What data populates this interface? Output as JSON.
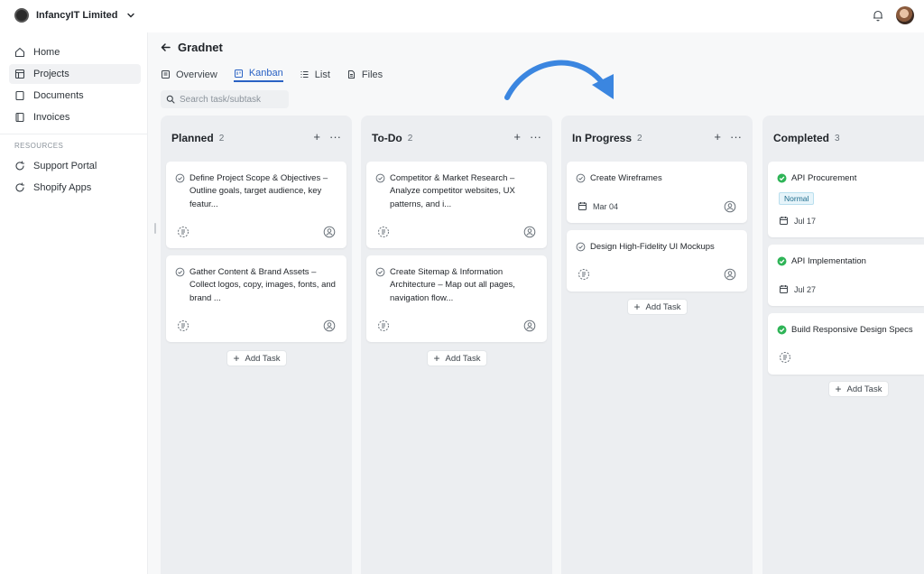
{
  "app": {
    "org_name": "InfancyIT Limited",
    "colors": {
      "accent": "#2a62c4",
      "success": "#2fb457",
      "badge": "#1d6b8b"
    }
  },
  "sidebar": {
    "items": [
      {
        "label": "Home",
        "icon": "home-icon"
      },
      {
        "label": "Projects",
        "icon": "projects-icon"
      },
      {
        "label": "Documents",
        "icon": "document-icon"
      },
      {
        "label": "Invoices",
        "icon": "invoice-icon"
      }
    ],
    "section_label": "RESOURCES",
    "resources": [
      {
        "label": "Support Portal",
        "icon": "refresh-icon"
      },
      {
        "label": "Shopify Apps",
        "icon": "refresh-icon"
      }
    ]
  },
  "project": {
    "title": "Gradnet",
    "tabs": [
      {
        "label": "Overview",
        "icon": "overview-icon"
      },
      {
        "label": "Kanban",
        "icon": "kanban-icon",
        "active": true
      },
      {
        "label": "List",
        "icon": "list-icon"
      },
      {
        "label": "Files",
        "icon": "file-icon"
      }
    ],
    "search_placeholder": "Search task/subtask"
  },
  "board": {
    "add_task_label": "Add Task",
    "add_icon": "+",
    "more_icon": "···",
    "columns": [
      {
        "title": "Planned",
        "count": "2",
        "cards": [
          {
            "title": "Define Project Scope & Objectives – Outline goals, target audience, key featur..."
          },
          {
            "title": "Gather Content & Brand Assets – Collect logos, copy, images, fonts, and brand ..."
          }
        ]
      },
      {
        "title": "To-Do",
        "count": "2",
        "cards": [
          {
            "title": "Competitor & Market Research – Analyze competitor websites, UX patterns, and i..."
          },
          {
            "title": "Create Sitemap & Information Architecture – Map out all pages, navigation flow..."
          }
        ]
      },
      {
        "title": "In Progress",
        "count": "2",
        "cards": [
          {
            "title": "Create Wireframes",
            "date": "Mar 04"
          },
          {
            "title": "Design High-Fidelity UI Mockups"
          }
        ]
      },
      {
        "title": "Completed",
        "count": "3",
        "cards": [
          {
            "title": "API Procurement",
            "badge": "Normal",
            "date": "Jul 17",
            "status": "done"
          },
          {
            "title": "API Implementation",
            "date": "Jul 27",
            "status": "done"
          },
          {
            "title": "Build Responsive Design Specs",
            "status": "done"
          }
        ]
      }
    ]
  }
}
